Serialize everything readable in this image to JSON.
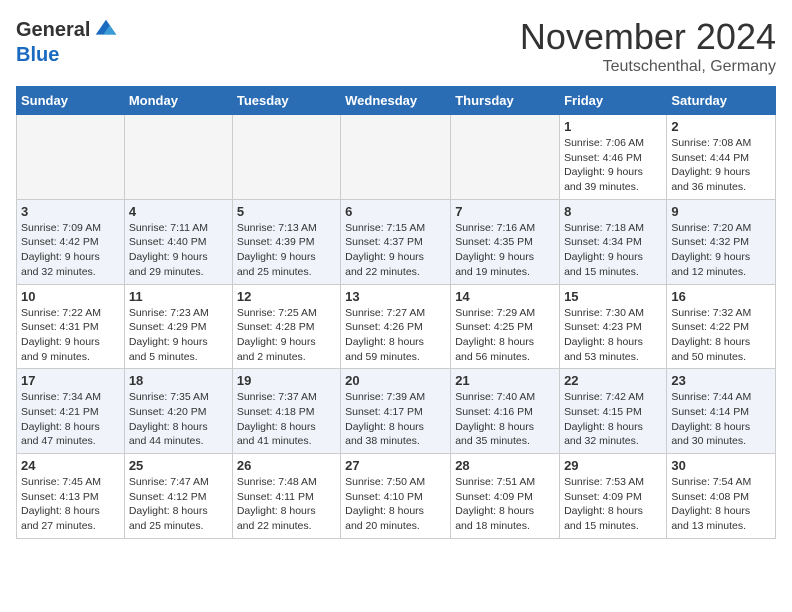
{
  "header": {
    "logo_general": "General",
    "logo_blue": "Blue",
    "month_title": "November 2024",
    "location": "Teutschenthal, Germany"
  },
  "weekdays": [
    "Sunday",
    "Monday",
    "Tuesday",
    "Wednesday",
    "Thursday",
    "Friday",
    "Saturday"
  ],
  "weeks": [
    [
      {
        "day": "",
        "info": ""
      },
      {
        "day": "",
        "info": ""
      },
      {
        "day": "",
        "info": ""
      },
      {
        "day": "",
        "info": ""
      },
      {
        "day": "",
        "info": ""
      },
      {
        "day": "1",
        "info": "Sunrise: 7:06 AM\nSunset: 4:46 PM\nDaylight: 9 hours\nand 39 minutes."
      },
      {
        "day": "2",
        "info": "Sunrise: 7:08 AM\nSunset: 4:44 PM\nDaylight: 9 hours\nand 36 minutes."
      }
    ],
    [
      {
        "day": "3",
        "info": "Sunrise: 7:09 AM\nSunset: 4:42 PM\nDaylight: 9 hours\nand 32 minutes."
      },
      {
        "day": "4",
        "info": "Sunrise: 7:11 AM\nSunset: 4:40 PM\nDaylight: 9 hours\nand 29 minutes."
      },
      {
        "day": "5",
        "info": "Sunrise: 7:13 AM\nSunset: 4:39 PM\nDaylight: 9 hours\nand 25 minutes."
      },
      {
        "day": "6",
        "info": "Sunrise: 7:15 AM\nSunset: 4:37 PM\nDaylight: 9 hours\nand 22 minutes."
      },
      {
        "day": "7",
        "info": "Sunrise: 7:16 AM\nSunset: 4:35 PM\nDaylight: 9 hours\nand 19 minutes."
      },
      {
        "day": "8",
        "info": "Sunrise: 7:18 AM\nSunset: 4:34 PM\nDaylight: 9 hours\nand 15 minutes."
      },
      {
        "day": "9",
        "info": "Sunrise: 7:20 AM\nSunset: 4:32 PM\nDaylight: 9 hours\nand 12 minutes."
      }
    ],
    [
      {
        "day": "10",
        "info": "Sunrise: 7:22 AM\nSunset: 4:31 PM\nDaylight: 9 hours\nand 9 minutes."
      },
      {
        "day": "11",
        "info": "Sunrise: 7:23 AM\nSunset: 4:29 PM\nDaylight: 9 hours\nand 5 minutes."
      },
      {
        "day": "12",
        "info": "Sunrise: 7:25 AM\nSunset: 4:28 PM\nDaylight: 9 hours\nand 2 minutes."
      },
      {
        "day": "13",
        "info": "Sunrise: 7:27 AM\nSunset: 4:26 PM\nDaylight: 8 hours\nand 59 minutes."
      },
      {
        "day": "14",
        "info": "Sunrise: 7:29 AM\nSunset: 4:25 PM\nDaylight: 8 hours\nand 56 minutes."
      },
      {
        "day": "15",
        "info": "Sunrise: 7:30 AM\nSunset: 4:23 PM\nDaylight: 8 hours\nand 53 minutes."
      },
      {
        "day": "16",
        "info": "Sunrise: 7:32 AM\nSunset: 4:22 PM\nDaylight: 8 hours\nand 50 minutes."
      }
    ],
    [
      {
        "day": "17",
        "info": "Sunrise: 7:34 AM\nSunset: 4:21 PM\nDaylight: 8 hours\nand 47 minutes."
      },
      {
        "day": "18",
        "info": "Sunrise: 7:35 AM\nSunset: 4:20 PM\nDaylight: 8 hours\nand 44 minutes."
      },
      {
        "day": "19",
        "info": "Sunrise: 7:37 AM\nSunset: 4:18 PM\nDaylight: 8 hours\nand 41 minutes."
      },
      {
        "day": "20",
        "info": "Sunrise: 7:39 AM\nSunset: 4:17 PM\nDaylight: 8 hours\nand 38 minutes."
      },
      {
        "day": "21",
        "info": "Sunrise: 7:40 AM\nSunset: 4:16 PM\nDaylight: 8 hours\nand 35 minutes."
      },
      {
        "day": "22",
        "info": "Sunrise: 7:42 AM\nSunset: 4:15 PM\nDaylight: 8 hours\nand 32 minutes."
      },
      {
        "day": "23",
        "info": "Sunrise: 7:44 AM\nSunset: 4:14 PM\nDaylight: 8 hours\nand 30 minutes."
      }
    ],
    [
      {
        "day": "24",
        "info": "Sunrise: 7:45 AM\nSunset: 4:13 PM\nDaylight: 8 hours\nand 27 minutes."
      },
      {
        "day": "25",
        "info": "Sunrise: 7:47 AM\nSunset: 4:12 PM\nDaylight: 8 hours\nand 25 minutes."
      },
      {
        "day": "26",
        "info": "Sunrise: 7:48 AM\nSunset: 4:11 PM\nDaylight: 8 hours\nand 22 minutes."
      },
      {
        "day": "27",
        "info": "Sunrise: 7:50 AM\nSunset: 4:10 PM\nDaylight: 8 hours\nand 20 minutes."
      },
      {
        "day": "28",
        "info": "Sunrise: 7:51 AM\nSunset: 4:09 PM\nDaylight: 8 hours\nand 18 minutes."
      },
      {
        "day": "29",
        "info": "Sunrise: 7:53 AM\nSunset: 4:09 PM\nDaylight: 8 hours\nand 15 minutes."
      },
      {
        "day": "30",
        "info": "Sunrise: 7:54 AM\nSunset: 4:08 PM\nDaylight: 8 hours\nand 13 minutes."
      }
    ]
  ]
}
